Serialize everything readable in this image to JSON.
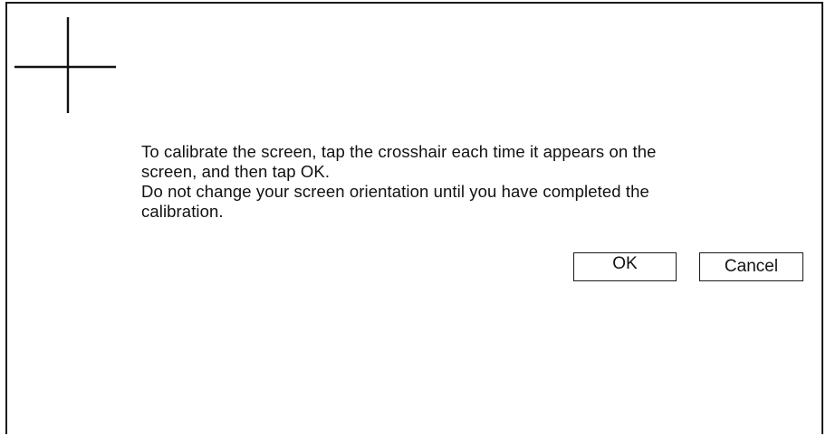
{
  "calibration": {
    "crosshair_icon": "crosshair-icon",
    "message_line1": "To  calibrate the screen, tap the crosshair each time it appears on the\nscreen, and then tap OK.",
    "message_line2": "Do not change your screen orientation until you have completed the\ncalibration.",
    "ok_label": "OK",
    "cancel_label": "Cancel"
  },
  "colors": {
    "background": "#ffffff",
    "border": "#1a1a1a",
    "text": "#111111"
  }
}
